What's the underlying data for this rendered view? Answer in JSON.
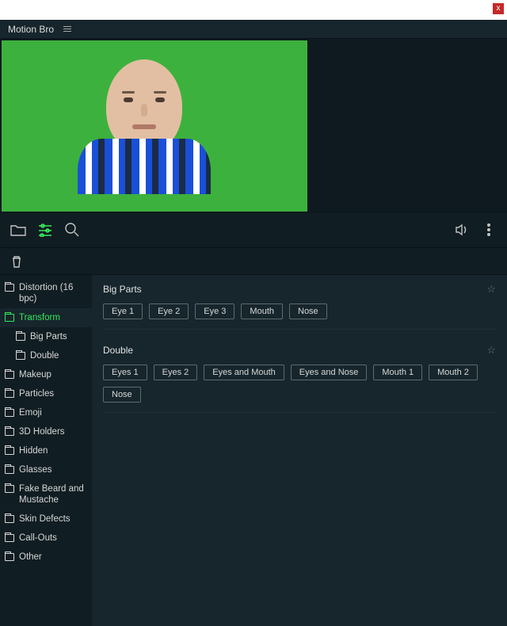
{
  "app": {
    "title": "Motion Bro",
    "close": "x"
  },
  "sidebar": {
    "items": [
      {
        "label": "Distortion (16 bpc)"
      },
      {
        "label": "Transform",
        "active": true
      },
      {
        "label": "Big Parts",
        "sub": true
      },
      {
        "label": "Double",
        "sub": true
      },
      {
        "label": "Makeup"
      },
      {
        "label": "Particles"
      },
      {
        "label": "Emoji"
      },
      {
        "label": "3D Holders"
      },
      {
        "label": "Hidden"
      },
      {
        "label": "Glasses"
      },
      {
        "label": "Fake Beard and Mustache"
      },
      {
        "label": "Skin Defects"
      },
      {
        "label": "Call-Outs"
      },
      {
        "label": "Other"
      }
    ]
  },
  "sections": [
    {
      "title": "Big Parts",
      "chips": [
        "Eye 1",
        "Eye 2",
        "Eye 3",
        "Mouth",
        "Nose"
      ]
    },
    {
      "title": "Double",
      "chips": [
        "Eyes 1",
        "Eyes 2",
        "Eyes and Mouth",
        "Eyes and Nose",
        "Mouth 1",
        "Mouth 2",
        "Nose"
      ]
    }
  ]
}
